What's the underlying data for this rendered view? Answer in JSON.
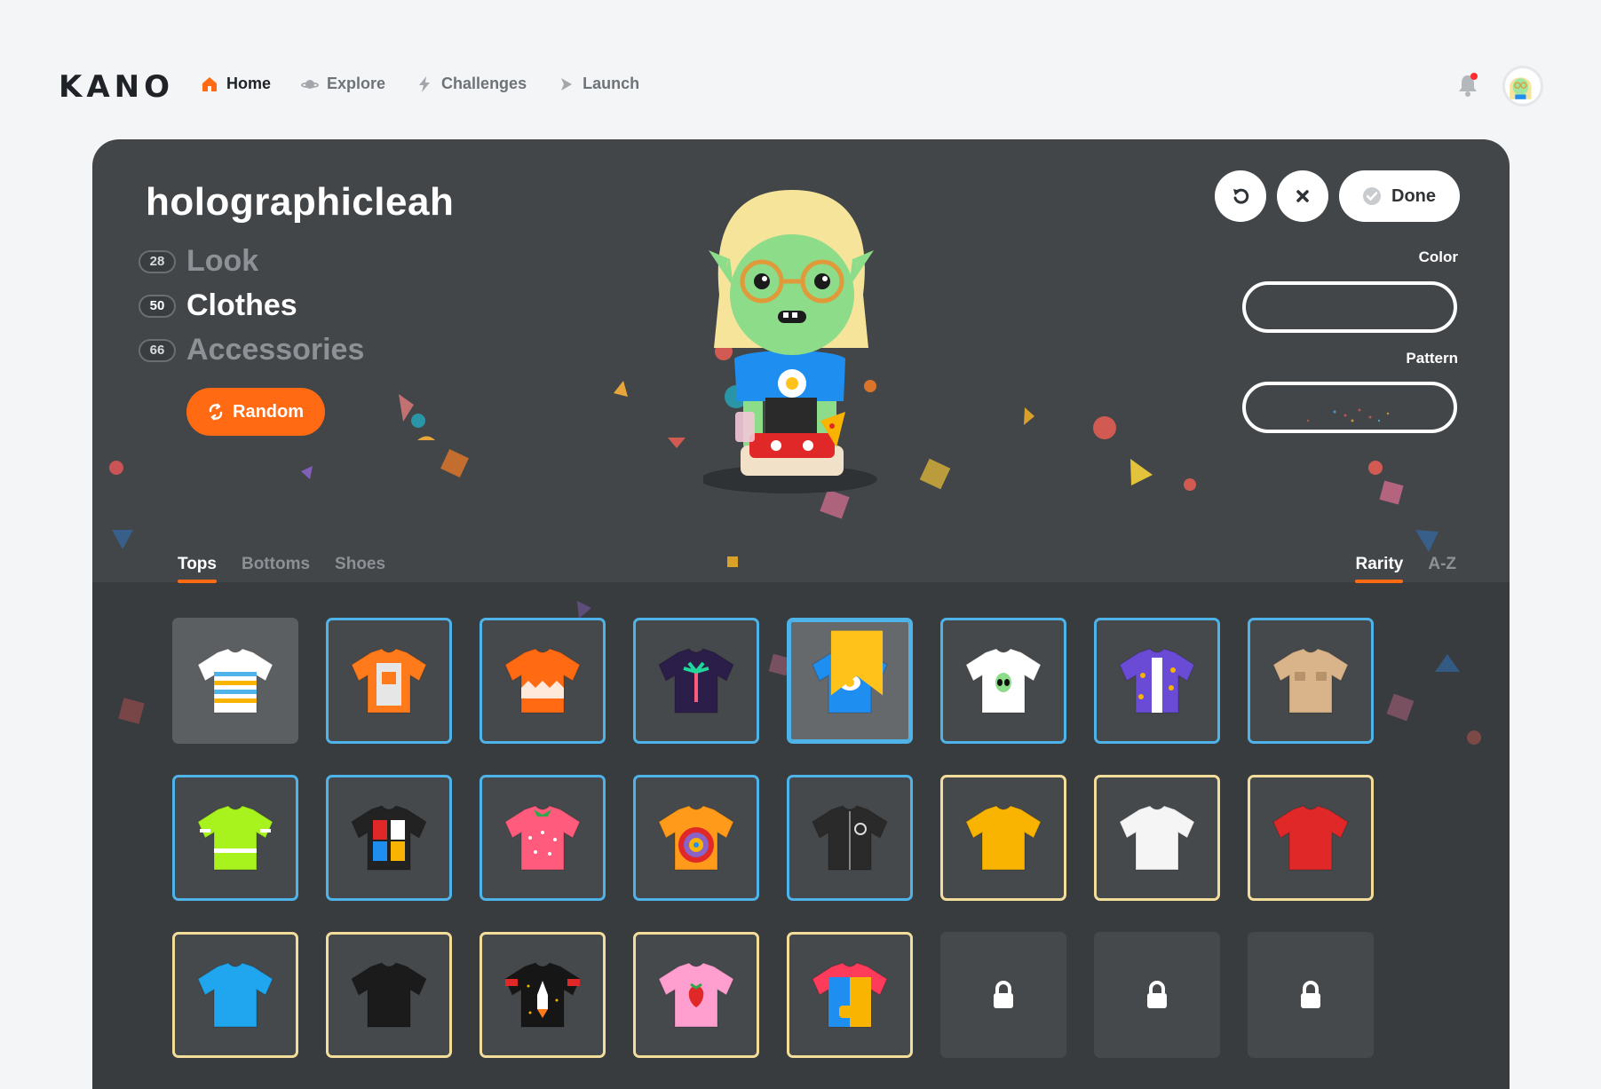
{
  "app": {
    "logo": "KANO"
  },
  "nav": {
    "items": [
      {
        "label": "Home",
        "icon": "home-icon",
        "active": true
      },
      {
        "label": "Explore",
        "icon": "planet-icon",
        "active": false
      },
      {
        "label": "Challenges",
        "icon": "lightning-icon",
        "active": false
      },
      {
        "label": "Launch",
        "icon": "play-icon",
        "active": false
      }
    ],
    "notification_icon": "bell-icon",
    "avatar_icon": "user-avatar"
  },
  "profile": {
    "username": "holographicleah",
    "categories": [
      {
        "count": "28",
        "label": "Look",
        "active": false
      },
      {
        "count": "50",
        "label": "Clothes",
        "active": true
      },
      {
        "count": "66",
        "label": "Accessories",
        "active": false
      }
    ],
    "random_label": "Random"
  },
  "actions": {
    "undo_icon": "undo-icon",
    "close_icon": "close-icon",
    "done_label": "Done"
  },
  "customize": {
    "color_label": "Color",
    "pattern_label": "Pattern"
  },
  "tabs": [
    {
      "label": "Tops",
      "active": true
    },
    {
      "label": "Bottoms",
      "active": false
    },
    {
      "label": "Shoes",
      "active": false
    }
  ],
  "sort": [
    {
      "label": "Rarity",
      "active": true
    },
    {
      "label": "A-Z",
      "active": false
    }
  ],
  "items": [
    {
      "name": "striped-tee",
      "state": "equipped",
      "color": "#ffffff"
    },
    {
      "name": "astronaut-hoodie",
      "state": "rare",
      "color": "#ff7a1a"
    },
    {
      "name": "kano-zigzag-tee",
      "state": "rare",
      "color": "#ff6a13"
    },
    {
      "name": "palm-tree-tee",
      "state": "rare",
      "color": "#2b1f4a"
    },
    {
      "name": "egg-tee",
      "state": "selected",
      "color": "#1e8ff0"
    },
    {
      "name": "alien-tee",
      "state": "rare",
      "color": "#ffffff"
    },
    {
      "name": "pizza-shirt",
      "state": "rare",
      "color": "#6a4bd6"
    },
    {
      "name": "safari-jacket",
      "state": "rare",
      "color": "#d9b48a"
    },
    {
      "name": "neon-jacket",
      "state": "rare",
      "color": "#a8f21e"
    },
    {
      "name": "mondrian-jacket",
      "state": "rare",
      "color": "#222222"
    },
    {
      "name": "strawberry-sweater",
      "state": "rare",
      "color": "#ff5b7d"
    },
    {
      "name": "tie-dye-tank",
      "state": "rare",
      "color": "#ff9a1a"
    },
    {
      "name": "bomber-jacket",
      "state": "rare",
      "color": "#2a2a2a"
    },
    {
      "name": "yellow-tee",
      "state": "common",
      "color": "#f8b400"
    },
    {
      "name": "white-tee",
      "state": "common",
      "color": "#f5f5f5"
    },
    {
      "name": "red-tee",
      "state": "common",
      "color": "#e02828"
    },
    {
      "name": "blue-tee",
      "state": "common",
      "color": "#1fa6ee"
    },
    {
      "name": "black-tee",
      "state": "common",
      "color": "#1b1b1b"
    },
    {
      "name": "rocket-tee",
      "state": "common",
      "color": "#161616"
    },
    {
      "name": "strawberry-crop",
      "state": "common",
      "color": "#ff9fd0"
    },
    {
      "name": "colorblock-hoodie",
      "state": "common",
      "color": "#ff3b5c"
    },
    {
      "name": "locked-item",
      "state": "locked",
      "color": "#ffffff"
    },
    {
      "name": "locked-item",
      "state": "locked",
      "color": "#ffffff"
    },
    {
      "name": "locked-item",
      "state": "locked",
      "color": "#ffffff"
    }
  ],
  "colors": {
    "accent": "#ff6a13",
    "panel": "#424649",
    "rare_border": "#4eb3e8",
    "common_border": "#f2dd9a"
  }
}
